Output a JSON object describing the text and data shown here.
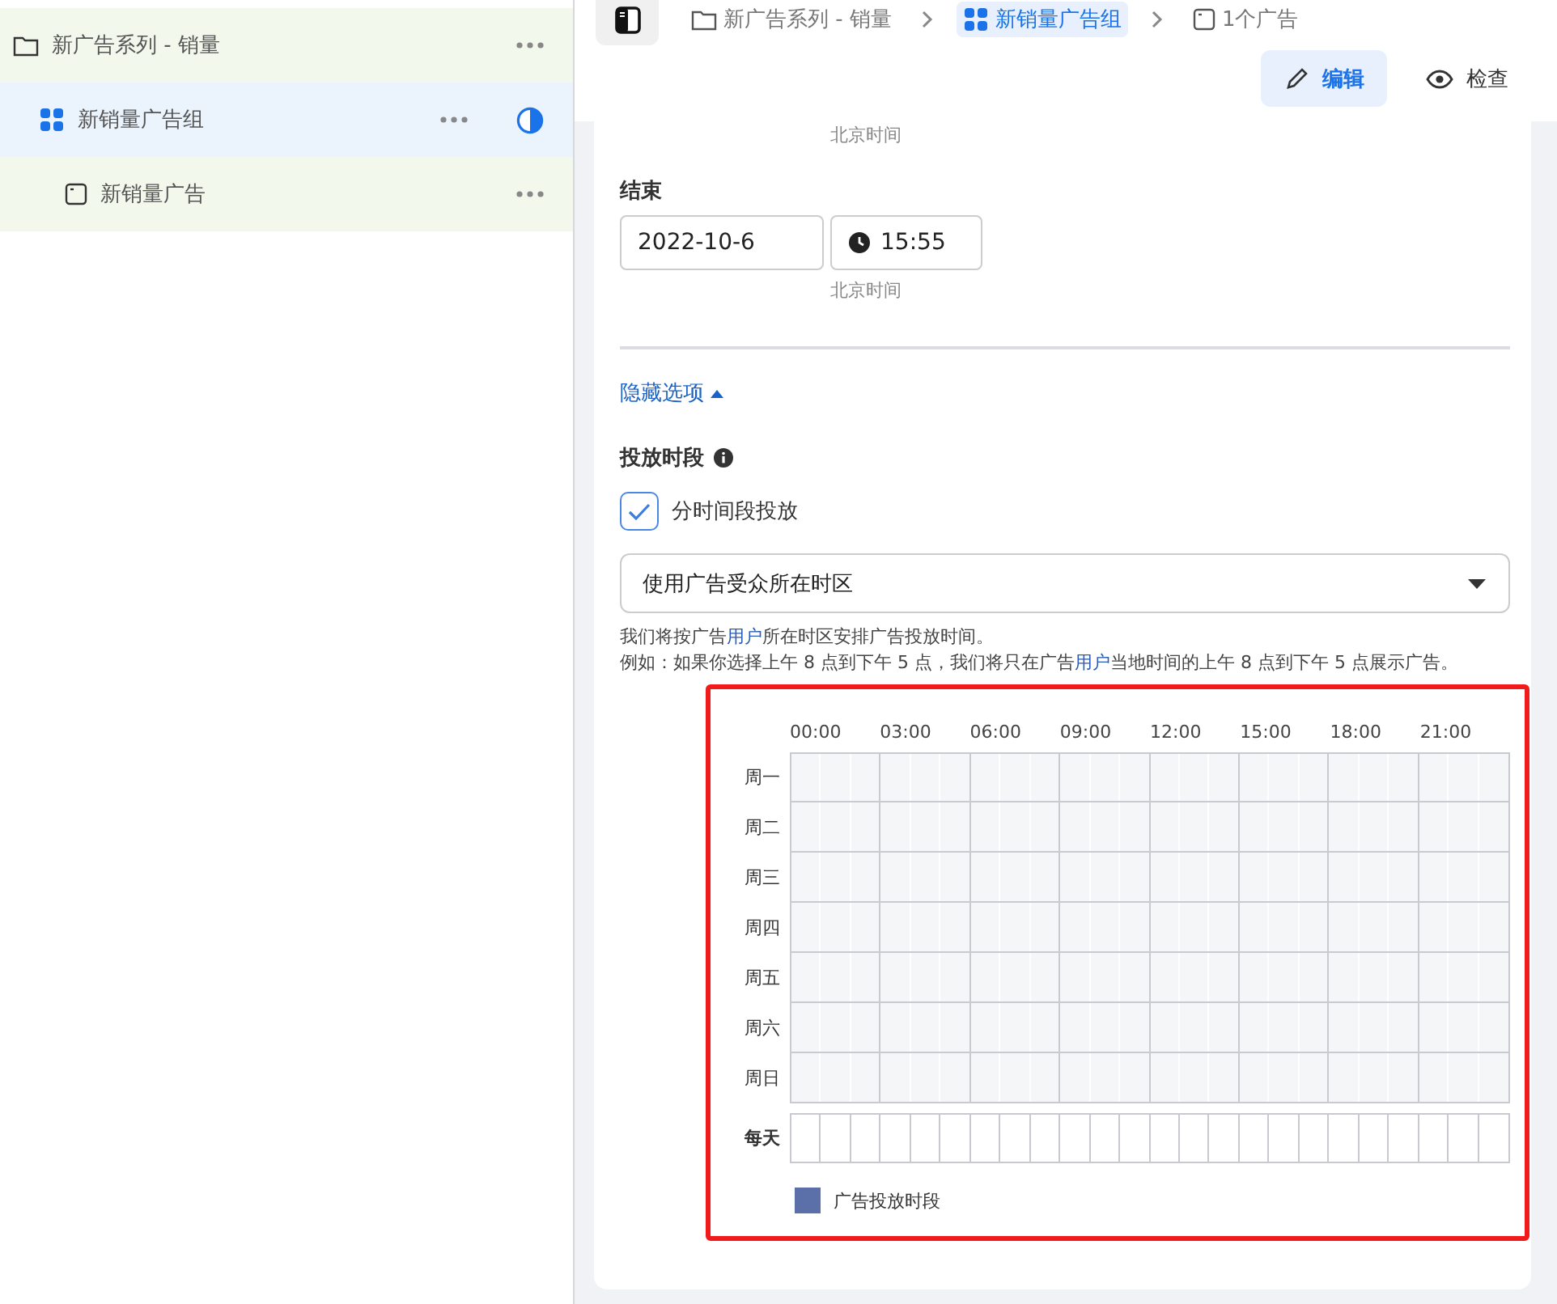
{
  "sidebar": {
    "items": [
      {
        "label": "新广告系列 - 销量",
        "kind": "campaign",
        "selected": false,
        "children": [
          {
            "label": "新销量广告组",
            "kind": "adset",
            "selected": true,
            "children": [
              {
                "label": "新销量广告",
                "kind": "ad",
                "selected": false
              }
            ]
          }
        ]
      }
    ]
  },
  "breadcrumbs": [
    {
      "label": "新广告系列 - 销量",
      "kind": "campaign",
      "selected": false
    },
    {
      "label": "新销量广告组",
      "kind": "adset",
      "selected": true
    },
    {
      "label": "1个广告",
      "kind": "ad",
      "selected": false
    }
  ],
  "actions": [
    {
      "label": "编辑",
      "kind": "edit",
      "selected": true
    },
    {
      "label": "检查",
      "kind": "view",
      "selected": false
    }
  ],
  "start": {
    "timezone_note": "北京时间"
  },
  "end": {
    "label": "结束",
    "date": "2022-10-6",
    "time": "15:55",
    "timezone_note": "北京时间"
  },
  "hide_options": {
    "label": "隐藏选项",
    "expanded": true
  },
  "schedule": {
    "title": "投放时段",
    "checkbox": {
      "label": "分时间段投放",
      "checked": true
    },
    "timezone_select": "使用广告受众所在时区",
    "help": [
      [
        {
          "kind": "text",
          "text": "我们将按广告"
        },
        {
          "kind": "link",
          "text": "用户"
        },
        {
          "kind": "text",
          "text": "所在时区安排广告投放时间。"
        }
      ],
      [
        {
          "kind": "text",
          "text": "例如：如果你选择上午 8 点到下午 5 点，我们将只在广告"
        },
        {
          "kind": "link",
          "text": "用户"
        },
        {
          "kind": "text",
          "text": "当地时间的上午 8 点到下午 5 点展示广告。"
        }
      ]
    ],
    "hours": [
      "00:00",
      "03:00",
      "06:00",
      "09:00",
      "12:00",
      "15:00",
      "18:00",
      "21:00"
    ],
    "days": [
      "周一",
      "周二",
      "周三",
      "周四",
      "周五",
      "周六",
      "周日"
    ],
    "every_day": "每天",
    "legend": {
      "label": "广告投放时段",
      "color": "#5b6fa8"
    }
  }
}
